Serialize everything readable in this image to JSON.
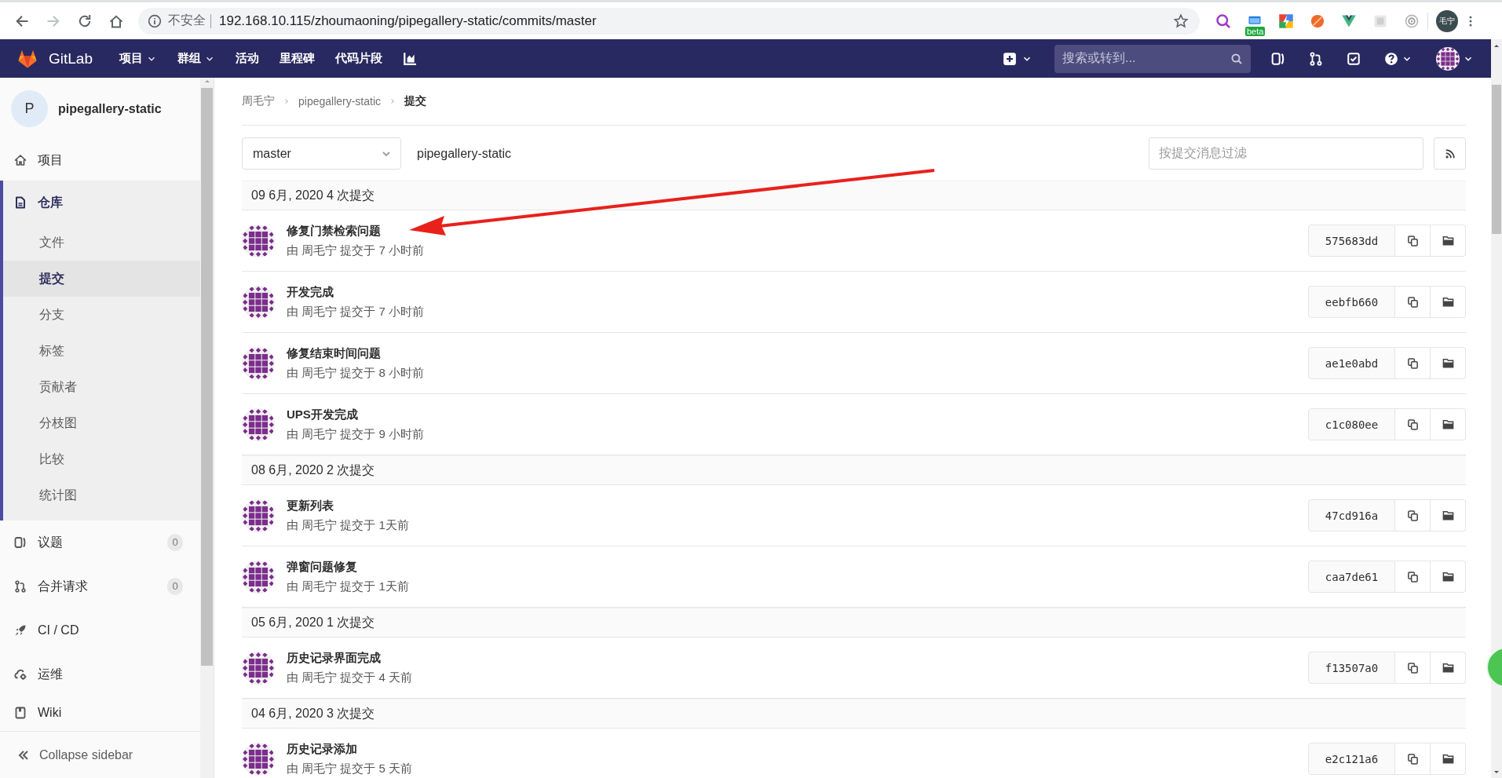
{
  "browser": {
    "nav_buttons": [
      {
        "kind": "back",
        "disabled": false
      },
      {
        "kind": "forward",
        "disabled": true
      },
      {
        "kind": "reload",
        "disabled": false
      },
      {
        "kind": "home",
        "disabled": false
      }
    ],
    "security_label": "不安全",
    "url": "192.168.10.115/zhoumaoning/pipegallery-static/commits/master",
    "extensions": [
      {
        "kind": "magnifier"
      },
      {
        "kind": "window",
        "badge": "beta"
      },
      {
        "kind": "bolt"
      },
      {
        "kind": "ball"
      },
      {
        "kind": "vee"
      },
      {
        "kind": "tile"
      },
      {
        "kind": "ring"
      }
    ],
    "profile": "毛宁"
  },
  "navbar": {
    "brand": "GitLab",
    "menu": [
      {
        "label": "项目",
        "dropdown": true
      },
      {
        "label": "群组",
        "dropdown": true
      },
      {
        "label": "活动",
        "dropdown": false
      },
      {
        "label": "里程碑",
        "dropdown": false
      },
      {
        "label": "代码片段",
        "dropdown": false
      }
    ],
    "search": {
      "placeholder": "搜索或转到..."
    }
  },
  "sidebar": {
    "project": {
      "avatar": "P",
      "name": "pipegallery-static"
    },
    "items": [
      {
        "kind": "home",
        "label": "项目",
        "selected": false
      },
      {
        "kind": "repository",
        "label": "仓库",
        "selected": true,
        "children": [
          {
            "label": "文件",
            "selected": false
          },
          {
            "label": "提交",
            "selected": true
          },
          {
            "label": "分支",
            "selected": false
          },
          {
            "label": "标签",
            "selected": false
          },
          {
            "label": "贡献者",
            "selected": false
          },
          {
            "label": "分枝图",
            "selected": false
          },
          {
            "label": "比较",
            "selected": false
          },
          {
            "label": "统计图",
            "selected": false
          }
        ]
      },
      {
        "kind": "issues",
        "label": "议题",
        "selected": false,
        "count": "0"
      },
      {
        "kind": "merge",
        "label": "合并请求",
        "selected": false,
        "count": "0"
      },
      {
        "kind": "rocket",
        "label": "CI / CD",
        "selected": false
      },
      {
        "kind": "operations",
        "label": "运维",
        "selected": false
      },
      {
        "kind": "wiki",
        "label": "Wiki",
        "selected": false
      }
    ],
    "collapse": "Collapse sidebar"
  },
  "breadcrumb": [
    "周毛宁",
    "pipegallery-static",
    "提交"
  ],
  "toolbar": {
    "branch": "master",
    "project": "pipegallery-static",
    "filter": {
      "placeholder": "按提交消息过滤"
    }
  },
  "groups": [
    {
      "header": "09 6月, 2020 4 次提交",
      "commits": [
        {
          "title": "修复门禁检索问题",
          "meta": "由 周毛宁 提交于 7 小时前",
          "sha": "575683dd"
        },
        {
          "title": "开发完成",
          "meta": "由 周毛宁 提交于 7 小时前",
          "sha": "eebfb660"
        },
        {
          "title": "修复结束时间问题",
          "meta": "由 周毛宁 提交于 8 小时前",
          "sha": "ae1e0abd"
        },
        {
          "title": "UPS开发完成",
          "meta": "由 周毛宁 提交于 9 小时前",
          "sha": "c1c080ee"
        }
      ]
    },
    {
      "header": "08 6月, 2020 2 次提交",
      "commits": [
        {
          "title": "更新列表",
          "meta": "由 周毛宁 提交于 1天前",
          "sha": "47cd916a"
        },
        {
          "title": "弹窗问题修复",
          "meta": "由 周毛宁 提交于 1天前",
          "sha": "caa7de61"
        }
      ]
    },
    {
      "header": "05 6月, 2020 1 次提交",
      "commits": [
        {
          "title": "历史记录界面完成",
          "meta": "由 周毛宁 提交于 4 天前",
          "sha": "f13507a0"
        }
      ]
    },
    {
      "header": "04 6月, 2020 3 次提交",
      "commits": [
        {
          "title": "历史记录添加",
          "meta": "由 周毛宁 提交于 5 天前",
          "sha": "e2c121a6"
        }
      ]
    }
  ]
}
